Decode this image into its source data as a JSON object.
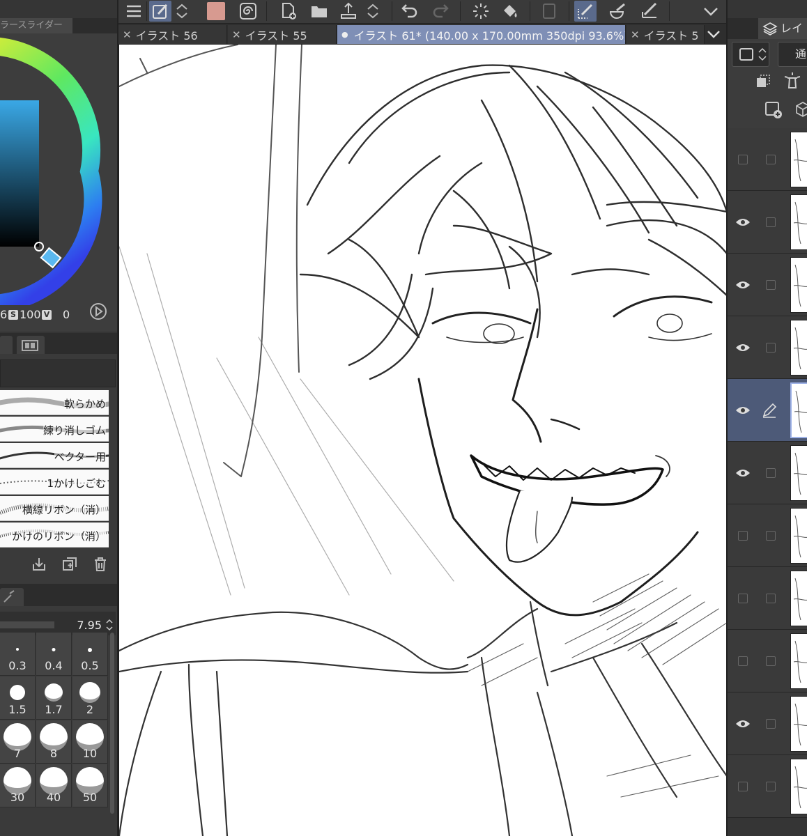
{
  "app": {
    "accent": "#7f8fb6",
    "canvas_bg": "#ffffff"
  },
  "color_panel": {
    "tab_label": "ラースライダー",
    "hsv": {
      "h": "6",
      "s_badge": "S",
      "s": "100",
      "v_badge": "V",
      "v": "0"
    }
  },
  "tabs": [
    {
      "label": "イラスト 56",
      "close": "✕"
    },
    {
      "label": "イラスト 55",
      "close": "✕"
    },
    {
      "label": "イラスト 61* (140.00 x 170.00mm 350dpi 93.6%)",
      "close": "●",
      "active": true
    },
    {
      "label": "イラスト 5",
      "close": "✕"
    }
  ],
  "brushes": [
    {
      "name": "軟らかめ"
    },
    {
      "name": "練り消しゴム"
    },
    {
      "name": "ベクター用"
    },
    {
      "name": "1かけしごむ"
    },
    {
      "name": "横線リボン（消）"
    },
    {
      "name": "かけのリボン（消）"
    }
  ],
  "brush_size": {
    "value": "7.95",
    "presets": [
      "0.3",
      "0.4",
      "0.5",
      "1.5",
      "1.7",
      "2",
      "7",
      "8",
      "10",
      "30",
      "40",
      "50"
    ]
  },
  "layers_panel": {
    "tab_label": "レイ",
    "blend_mode": "通"
  }
}
